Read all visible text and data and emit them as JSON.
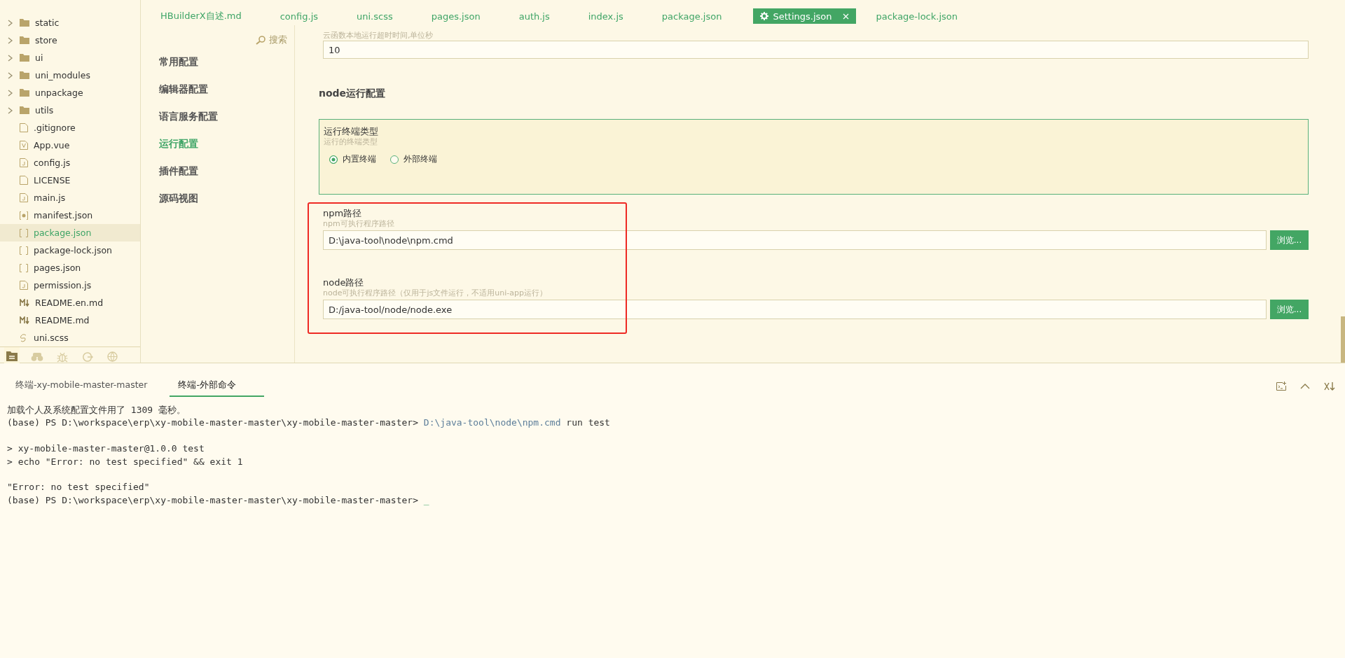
{
  "file_tree": {
    "items": [
      {
        "name": "static",
        "kind": "folder",
        "expanded": false,
        "selected": false
      },
      {
        "name": "store",
        "kind": "folder",
        "expanded": false,
        "selected": false
      },
      {
        "name": "ui",
        "kind": "folder",
        "expanded": false,
        "selected": false
      },
      {
        "name": "uni_modules",
        "kind": "folder",
        "expanded": false,
        "selected": false
      },
      {
        "name": "unpackage",
        "kind": "folder",
        "expanded": false,
        "selected": false
      },
      {
        "name": "utils",
        "kind": "folder",
        "expanded": false,
        "selected": false
      },
      {
        "name": ".gitignore",
        "kind": "file",
        "selected": false
      },
      {
        "name": "App.vue",
        "kind": "vue",
        "selected": false
      },
      {
        "name": "config.js",
        "kind": "js",
        "selected": false
      },
      {
        "name": "LICENSE",
        "kind": "file",
        "selected": false
      },
      {
        "name": "main.js",
        "kind": "js",
        "selected": false
      },
      {
        "name": "manifest.json",
        "kind": "manifest",
        "selected": false
      },
      {
        "name": "package.json",
        "kind": "json",
        "selected": true
      },
      {
        "name": "package-lock.json",
        "kind": "json",
        "selected": false
      },
      {
        "name": "pages.json",
        "kind": "json",
        "selected": false
      },
      {
        "name": "permission.js",
        "kind": "js",
        "selected": false
      },
      {
        "name": "README.en.md",
        "kind": "md",
        "selected": false
      },
      {
        "name": "README.md",
        "kind": "md",
        "selected": false
      },
      {
        "name": "uni.scss",
        "kind": "scss",
        "selected": false
      }
    ],
    "activity_bar": [
      {
        "kind": "files",
        "selected": true
      },
      {
        "kind": "binoculars",
        "selected": false
      },
      {
        "kind": "bug",
        "selected": false
      },
      {
        "kind": "sync",
        "selected": false
      },
      {
        "kind": "globe",
        "selected": false
      }
    ]
  },
  "editor_tabs": [
    {
      "label": "HBuilderX自述.md",
      "selected": false
    },
    {
      "label": "config.js",
      "selected": false
    },
    {
      "label": "uni.scss",
      "selected": false
    },
    {
      "label": "pages.json",
      "selected": false
    },
    {
      "label": "auth.js",
      "selected": false
    },
    {
      "label": "index.js",
      "selected": false
    },
    {
      "label": "package.json",
      "selected": false
    },
    {
      "label": "Settings.json",
      "selected": true
    },
    {
      "label": "package-lock.json",
      "selected": false
    }
  ],
  "settings": {
    "search": "搜索",
    "nav": [
      {
        "label": "常用配置",
        "selected": false
      },
      {
        "label": "编辑器配置",
        "selected": false
      },
      {
        "label": "语言服务配置",
        "selected": false
      },
      {
        "label": "运行配置",
        "selected": true
      },
      {
        "label": "插件配置",
        "selected": false
      },
      {
        "label": "源码视图",
        "selected": false
      }
    ],
    "timeout": {
      "hint": "云函数本地运行超时时间,单位秒",
      "value": "10"
    },
    "section_title": "node运行配置",
    "terminal_type": {
      "label": "运行终端类型",
      "hint": "运行的终端类型",
      "options": [
        {
          "label": "内置终端",
          "selected": true
        },
        {
          "label": "外部终端",
          "selected": false
        }
      ]
    },
    "paths": [
      {
        "label": "npm路径",
        "hint": "npm可执行程序路径",
        "value": "D:\\java-tool\\node\\npm.cmd",
        "button": "浏览..."
      },
      {
        "label": "node路径",
        "hint": "node可执行程序路径（仅用于js文件运行，不适用uni-app运行）",
        "value": "D:/java-tool/node/node.exe",
        "button": "浏览..."
      }
    ]
  },
  "terminal": {
    "tabs": [
      {
        "label": "终端-xy-mobile-master-master",
        "selected": false
      },
      {
        "label": "终端-外部命令",
        "selected": true
      }
    ],
    "lines": [
      {
        "kind": "text",
        "segments": [
          {
            "kind": "plain",
            "text": "加载个人及系统配置文件用了 1309 毫秒。"
          }
        ]
      },
      {
        "kind": "text",
        "segments": [
          {
            "kind": "plain",
            "text": "(base) PS D:\\workspace\\erp\\xy-mobile-master-master\\xy-mobile-master-master> "
          },
          {
            "kind": "path",
            "text": "D:\\java-tool\\node\\npm.cmd"
          },
          {
            "kind": "plain",
            "text": " run test"
          }
        ]
      },
      {
        "kind": "blank"
      },
      {
        "kind": "text",
        "segments": [
          {
            "kind": "plain",
            "text": "> xy-mobile-master-master@1.0.0 test"
          }
        ]
      },
      {
        "kind": "text",
        "segments": [
          {
            "kind": "plain",
            "text": "> echo \"Error: no test specified\" && exit 1"
          }
        ]
      },
      {
        "kind": "blank"
      },
      {
        "kind": "text",
        "segments": [
          {
            "kind": "plain",
            "text": "\"Error: no test specified\""
          }
        ]
      },
      {
        "kind": "text",
        "segments": [
          {
            "kind": "plain",
            "text": "(base) PS D:\\workspace\\erp\\xy-mobile-master-master\\xy-mobile-master-master> "
          },
          {
            "kind": "cursor",
            "text": "_"
          }
        ]
      }
    ]
  }
}
